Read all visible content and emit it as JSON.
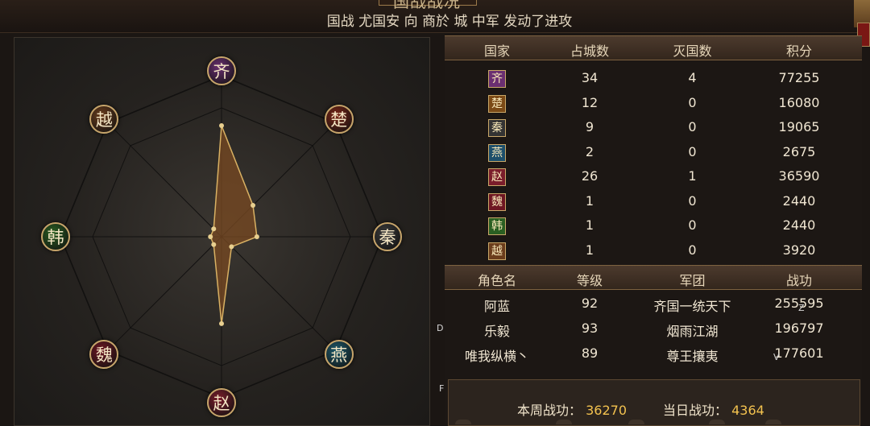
{
  "window_title": "国战战况",
  "battle_news": "国战 尤国安 向 商於 城 中军 发动了进攻",
  "radar": {
    "nations": [
      {
        "name": "齐",
        "color": "#6a2f71"
      },
      {
        "name": "楚",
        "color": "#7b2616"
      },
      {
        "name": "秦",
        "color": "#3a3a3a"
      },
      {
        "name": "燕",
        "color": "#1d5a6b"
      },
      {
        "name": "赵",
        "color": "#7a1d2b"
      },
      {
        "name": "魏",
        "color": "#6e1622"
      },
      {
        "name": "韩",
        "color": "#2a5f22"
      },
      {
        "name": "越",
        "color": "#6b3d1c"
      }
    ],
    "values": [
      34,
      12,
      9,
      2,
      26,
      1,
      1,
      1
    ],
    "max": 34,
    "fill_color": "#7a4a22",
    "line_color": "#d9b163"
  },
  "nation_table": {
    "headers": [
      "国家",
      "占城数",
      "灭国数",
      "积分"
    ],
    "rows": [
      {
        "nation": "齐",
        "cities": "34",
        "destroyed": "4",
        "score": "77255",
        "color": "#6a2f71"
      },
      {
        "nation": "楚",
        "cities": "12",
        "destroyed": "0",
        "score": "16080",
        "color": "#7b4a16"
      },
      {
        "nation": "秦",
        "cities": "9",
        "destroyed": "0",
        "score": "19065",
        "color": "#333333"
      },
      {
        "nation": "燕",
        "cities": "2",
        "destroyed": "0",
        "score": "2675",
        "color": "#1d4f6b"
      },
      {
        "nation": "赵",
        "cities": "26",
        "destroyed": "1",
        "score": "36590",
        "color": "#7a1d2b"
      },
      {
        "nation": "魏",
        "cities": "1",
        "destroyed": "0",
        "score": "2440",
        "color": "#6e1622"
      },
      {
        "nation": "韩",
        "cities": "1",
        "destroyed": "0",
        "score": "2440",
        "color": "#2a5f22"
      },
      {
        "nation": "越",
        "cities": "1",
        "destroyed": "0",
        "score": "3920",
        "color": "#6b3d1c"
      }
    ]
  },
  "player_table": {
    "headers": [
      "角色名",
      "等级",
      "军团",
      "战功"
    ],
    "rows": [
      {
        "name": "阿蓝",
        "level": "92",
        "legion": "齐国一统天下",
        "merit": "255595"
      },
      {
        "name": "乐毅",
        "level": "93",
        "legion": "烟雨江湖",
        "merit": "196797"
      },
      {
        "name": "唯我纵横丶",
        "level": "89",
        "legion": "尊王攘夷",
        "merit": "177601"
      }
    ]
  },
  "summary": {
    "week_label": "本周战功：",
    "week_value": "36270",
    "day_label": "当日战功：",
    "day_value": "4364"
  },
  "overlay_letters": {
    "d": "D",
    "f": "F",
    "z": "Z",
    "v": "V"
  }
}
